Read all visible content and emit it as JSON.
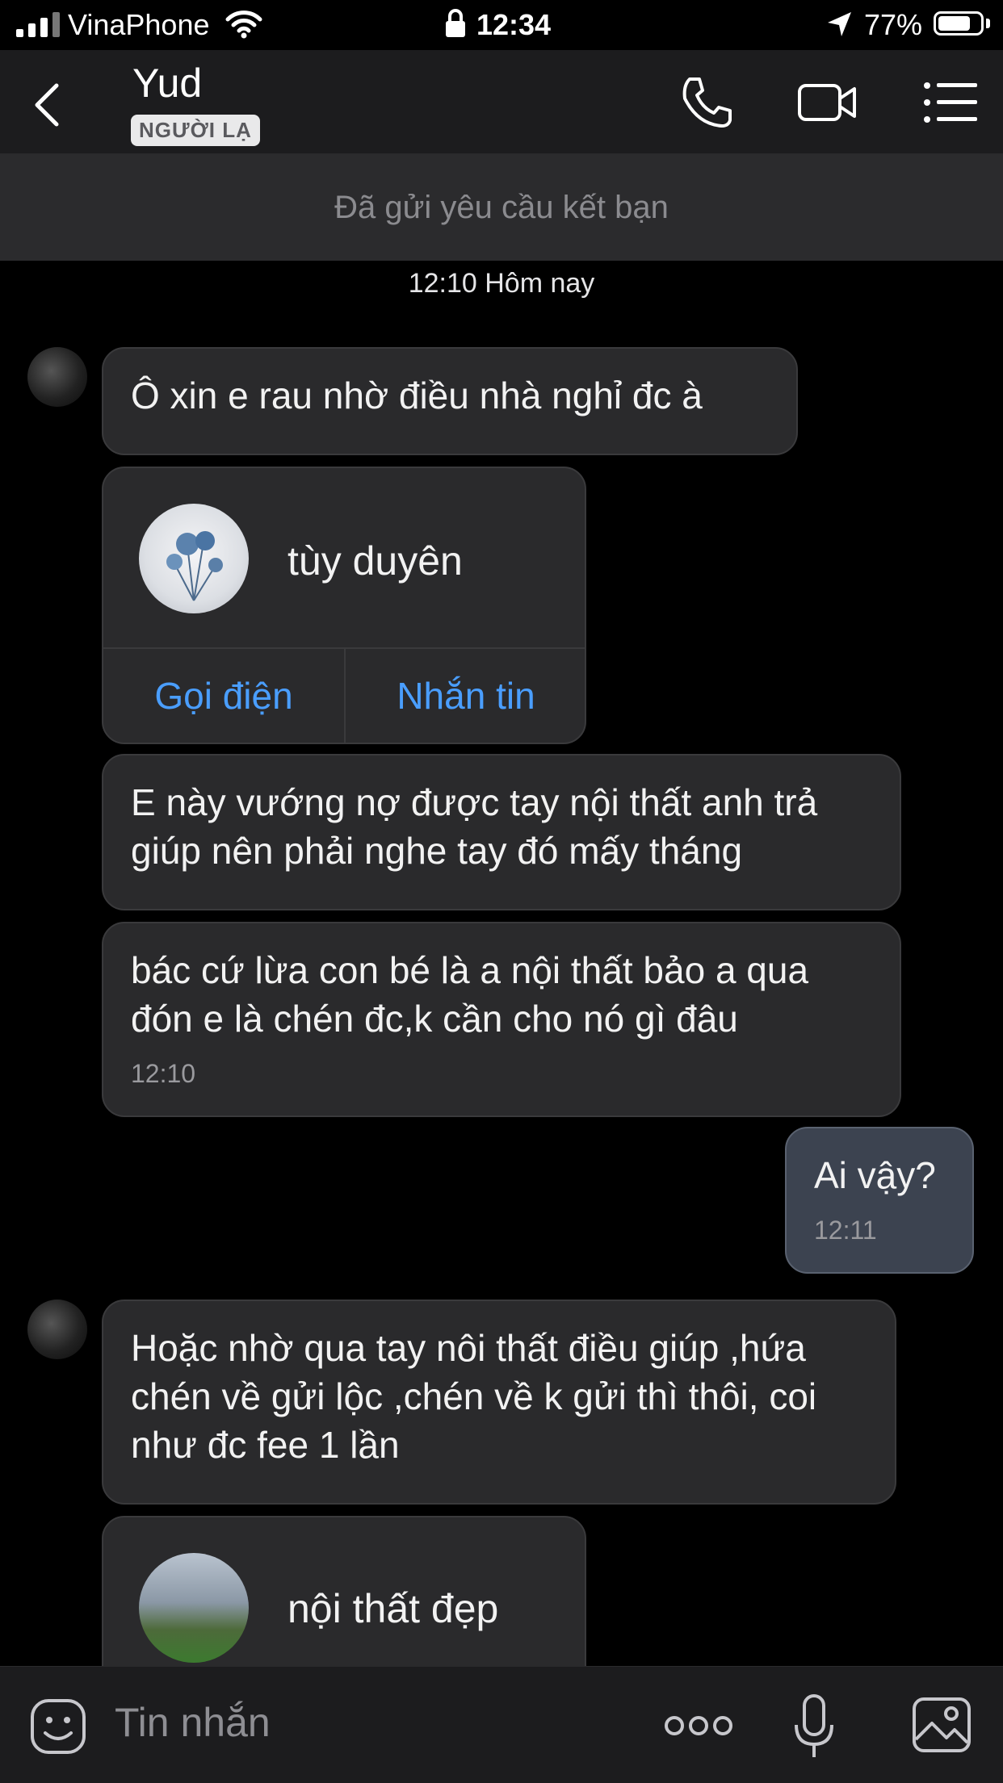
{
  "status_bar": {
    "carrier": "VinaPhone",
    "time": "12:34",
    "battery": "77%",
    "battery_level": 0.77
  },
  "header": {
    "contact_name": "Yud",
    "badge": "NGƯỜI LẠ",
    "icons": [
      "back-icon",
      "phone-icon",
      "video-icon",
      "menu-icon"
    ]
  },
  "friend_request": {
    "text": "Đã gửi yêu cầu kết bạn"
  },
  "chat": {
    "date_label": "12:10 Hôm nay",
    "messages": [
      {
        "text": "Ô xin e rau nhờ điều nhà nghỉ đc à"
      },
      {
        "card_name": "tùy duyên",
        "call_label": "Gọi điện",
        "message_label": "Nhắn tin"
      },
      {
        "text": "E này vướng nợ được tay nội thất anh trả giúp nên phải nghe tay đó mấy tháng"
      },
      {
        "text": "bác cứ lừa con bé là a nội thất bảo a qua đón e là chén đc,k cần cho nó gì đâu",
        "time": "12:10"
      },
      {
        "text": "Ai vậy?",
        "time": "12:11"
      },
      {
        "text": "Hoặc nhờ qua tay nôi thất điều giúp ,hứa chén về gửi lộc ,chén về k gửi thì thôi, coi như đc fee 1 lần"
      },
      {
        "card_name": "nội thất đẹp"
      }
    ]
  },
  "input_bar": {
    "placeholder": "Tin nhắn",
    "icons": [
      "sticker-icon",
      "more-icon",
      "microphone-icon",
      "image-icon"
    ]
  }
}
